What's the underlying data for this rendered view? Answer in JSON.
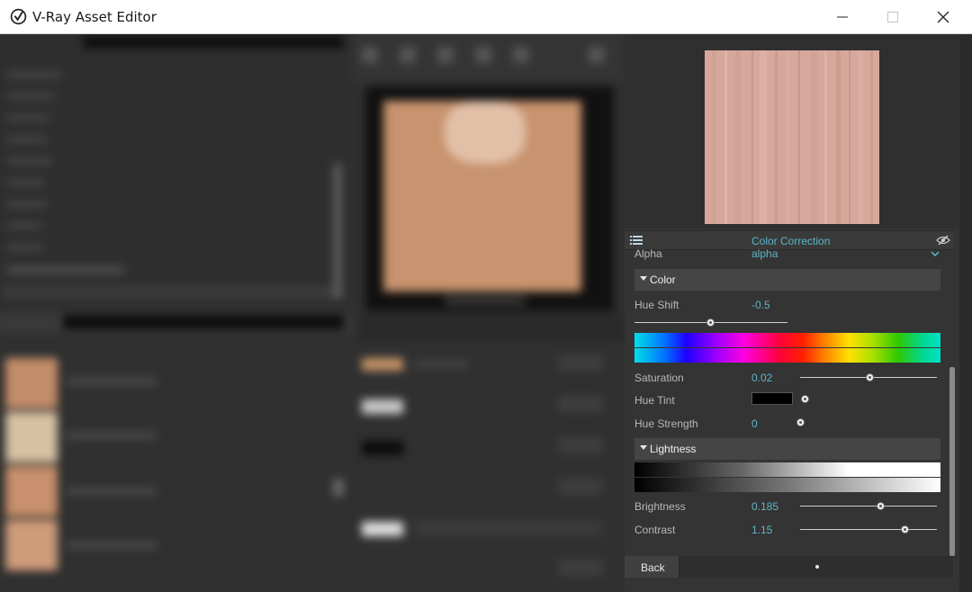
{
  "window": {
    "title": "V-Ray Asset Editor"
  },
  "panel": {
    "section_title": "Color Correction",
    "alpha": {
      "label": "Alpha",
      "value": "alpha"
    },
    "color_group": {
      "title": "Color",
      "hue_shift": {
        "label": "Hue Shift",
        "value": "-0.5",
        "level": 0.5
      },
      "saturation": {
        "label": "Saturation",
        "value": "0.02",
        "level": 0.51
      },
      "hue_tint": {
        "label": "Hue Tint",
        "color": "#000000"
      },
      "hue_strength": {
        "label": "Hue Strength",
        "value": "0",
        "level": 0.0
      }
    },
    "lightness_group": {
      "title": "Lightness",
      "brightness": {
        "label": "Brightness",
        "value": "0.185",
        "level": 0.59
      },
      "contrast": {
        "label": "Contrast",
        "value": "1.15",
        "level": 0.77
      }
    },
    "footer": {
      "back_label": "Back"
    }
  },
  "colors": {
    "accent": "#5fb4c6",
    "panel_bg": "#343434",
    "texture_base": "#d7a79c"
  },
  "icons": {
    "app_logo": "vray-logo-icon",
    "list": "list-icon",
    "visibility": "eye-hidden-icon",
    "dropdown": "chevron-down-icon"
  }
}
